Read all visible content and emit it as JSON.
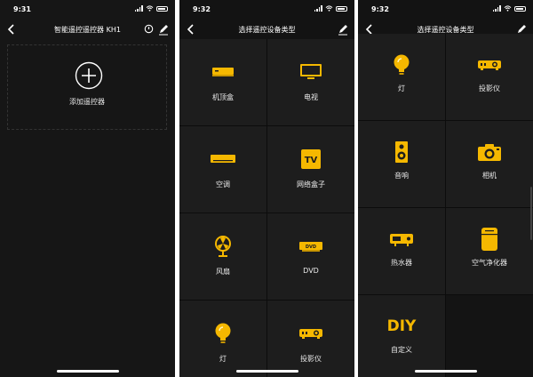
{
  "screen1": {
    "time": "9:31",
    "title": "智能遥控遥控器 KH1",
    "add_label": "添加遥控器"
  },
  "screen2": {
    "time": "9:32",
    "title": "选择遥控设备类型",
    "items": [
      {
        "label": "机顶盒",
        "icon": "set-top-box-icon"
      },
      {
        "label": "电视",
        "icon": "tv-icon"
      },
      {
        "label": "空调",
        "icon": "air-conditioner-icon"
      },
      {
        "label": "网络盒子",
        "icon": "network-box-icon"
      },
      {
        "label": "风扇",
        "icon": "fan-icon"
      },
      {
        "label": "DVD",
        "icon": "dvd-icon"
      },
      {
        "label": "灯",
        "icon": "lamp-icon"
      },
      {
        "label": "投影仪",
        "icon": "projector-icon"
      }
    ]
  },
  "screen3": {
    "time": "9:32",
    "title": "选择遥控设备类型",
    "items": [
      {
        "label": "灯",
        "icon": "lamp-icon"
      },
      {
        "label": "投影仪",
        "icon": "projector-icon"
      },
      {
        "label": "音响",
        "icon": "speaker-icon"
      },
      {
        "label": "相机",
        "icon": "camera-icon"
      },
      {
        "label": "热水器",
        "icon": "water-heater-icon"
      },
      {
        "label": "空气净化器",
        "icon": "air-purifier-icon"
      },
      {
        "label": "自定义",
        "icon": "diy-icon",
        "icon_text": "DIY"
      }
    ]
  },
  "colors": {
    "accent": "#f5b800",
    "background": "#131313",
    "cell": "#1d1d1d"
  }
}
